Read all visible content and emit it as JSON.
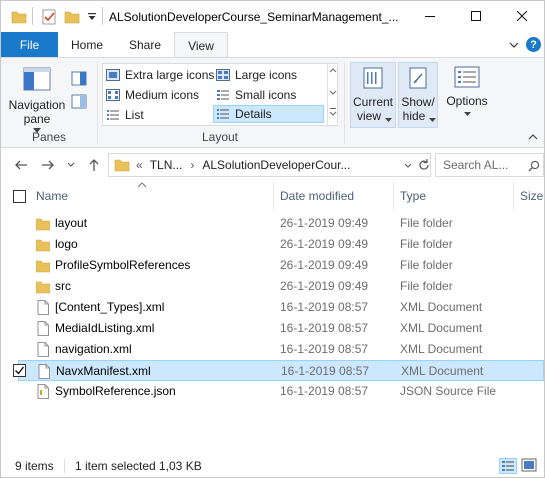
{
  "window": {
    "title": "ALSolutionDeveloperCourse_SeminarManagement_..."
  },
  "ribbon_tabs": [
    "File",
    "Home",
    "Share",
    "View"
  ],
  "ribbon": {
    "panes": {
      "nav_pane_line1": "Navigation",
      "nav_pane_line2": "pane",
      "group_label": "Panes"
    },
    "layout": {
      "group_label": "Layout",
      "items": [
        "Extra large icons",
        "Large icons",
        "Medium icons",
        "Small icons",
        "List",
        "Details"
      ],
      "selected": "Details"
    },
    "current_view": {
      "line1": "Current",
      "line2": "view"
    },
    "show_hide": {
      "line1": "Show/",
      "line2": "hide"
    },
    "options": {
      "label": "Options"
    }
  },
  "address": {
    "prefix": "«",
    "crumbs": [
      "TLN...",
      "ALSolutionDeveloperCour..."
    ],
    "search_placeholder": "Search AL..."
  },
  "columns": [
    "Name",
    "Date modified",
    "Type",
    "Size"
  ],
  "files": [
    {
      "name": "layout",
      "date": "26-1-2019 09:49",
      "type": "File folder",
      "kind": "folder"
    },
    {
      "name": "logo",
      "date": "26-1-2019 09:49",
      "type": "File folder",
      "kind": "folder"
    },
    {
      "name": "ProfileSymbolReferences",
      "date": "26-1-2019 09:49",
      "type": "File folder",
      "kind": "folder"
    },
    {
      "name": "src",
      "date": "26-1-2019 09:49",
      "type": "File folder",
      "kind": "folder"
    },
    {
      "name": "[Content_Types].xml",
      "date": "16-1-2019 08:57",
      "type": "XML Document",
      "kind": "file"
    },
    {
      "name": "MediaIdListing.xml",
      "date": "16-1-2019 08:57",
      "type": "XML Document",
      "kind": "file"
    },
    {
      "name": "navigation.xml",
      "date": "16-1-2019 08:57",
      "type": "XML Document",
      "kind": "file"
    },
    {
      "name": "NavxManifest.xml",
      "date": "16-1-2019 08:57",
      "type": "XML Document",
      "kind": "file"
    },
    {
      "name": "SymbolReference.json",
      "date": "16-1-2019 08:57",
      "type": "JSON Source File",
      "kind": "json"
    }
  ],
  "selected_file": "NavxManifest.xml",
  "status": {
    "item_count": "9 items",
    "selection": "1 item selected",
    "size": "1,03 KB"
  },
  "colors": {
    "file_tab": "#1979ca",
    "selection": "#cce8ff",
    "folder": "#e8c15a"
  }
}
